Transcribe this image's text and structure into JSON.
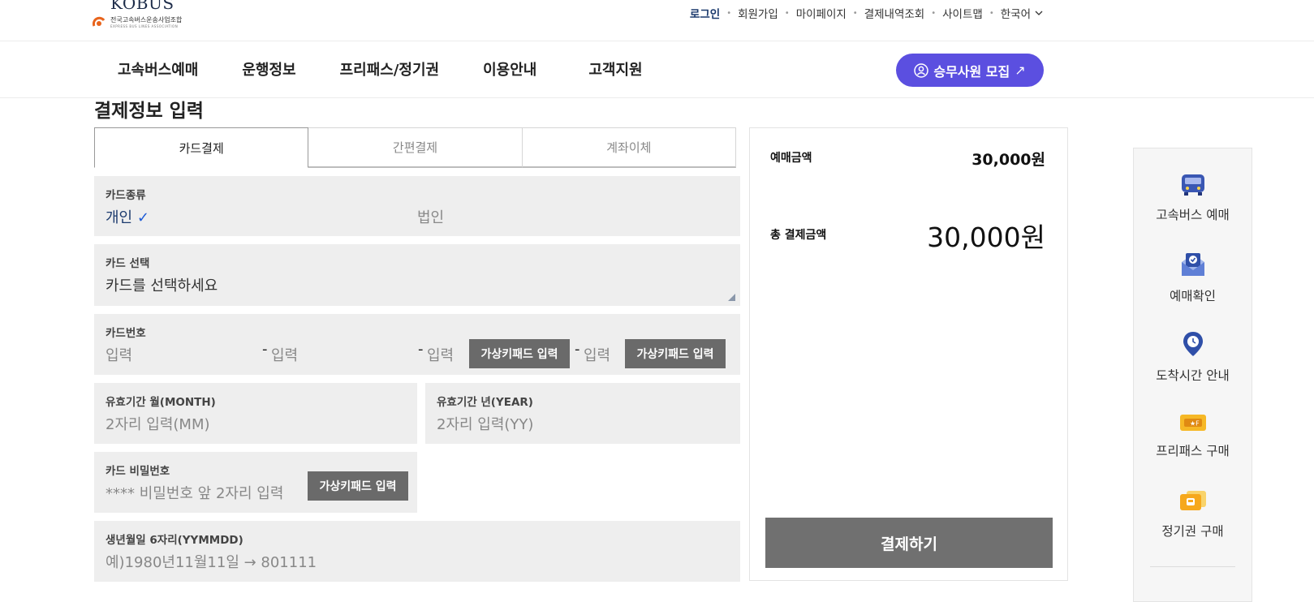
{
  "header": {
    "logo_text": "KOBUS",
    "logo_org": "전국고속버스운송사업조합",
    "logo_org_en": "EXPRESS BUS LINES ASSOCIATION",
    "util_links": [
      "로그인",
      "회원가입",
      "마이페이지",
      "결제내역조회",
      "사이트맵",
      "한국어"
    ],
    "nav": [
      "고속버스예매",
      "운행정보",
      "프리패스/정기권",
      "이용안내",
      "고객지원"
    ],
    "recruit_label": "승무사원 모집",
    "recruit_arrow": "↗"
  },
  "page": {
    "title": "결제정보 입력"
  },
  "tabs": [
    "카드결제",
    "간편결제",
    "계좌이체"
  ],
  "form": {
    "card_type": {
      "label": "카드종류",
      "personal": "개인",
      "check": "✓",
      "corporate": "법인"
    },
    "card_select": {
      "label": "카드 선택",
      "placeholder": "카드를 선택하세요"
    },
    "card_number": {
      "label": "카드번호",
      "placeholder": "입력",
      "separator": "-",
      "vk_label": "가상키패드 입력"
    },
    "expiry_month": {
      "label": "유효기간 월(MONTH)",
      "placeholder": "2자리 입력(MM)"
    },
    "expiry_year": {
      "label": "유효기간 년(YEAR)",
      "placeholder": "2자리 입력(YY)"
    },
    "card_password": {
      "label": "카드 비밀번호",
      "placeholder": "**** 비밀번호 앞 2자리 입력",
      "vk_label": "가상키패드 입력"
    },
    "birth": {
      "label": "생년월일 6자리(YYMMDD)",
      "placeholder": "예)1980년11월11일 → 801111"
    }
  },
  "summary": {
    "fare_label": "예매금액",
    "fare_value": "30,000원",
    "total_label": "총 결제금액",
    "total_value": "30,000원",
    "pay_button": "결제하기"
  },
  "quick_menu": [
    {
      "label": "고속버스 예매",
      "icon": "bus-icon"
    },
    {
      "label": "예매확인",
      "icon": "ticket-check-icon"
    },
    {
      "label": "도착시간 안내",
      "icon": "location-clock-icon"
    },
    {
      "label": "프리패스 구매",
      "icon": "freepass-ticket-icon"
    },
    {
      "label": "정기권 구매",
      "icon": "season-ticket-icon"
    }
  ],
  "colors": {
    "primary": "#5b4fe0",
    "navy": "#1b3a6d",
    "field_bg": "#eeeeee",
    "button_gray": "#707070"
  }
}
